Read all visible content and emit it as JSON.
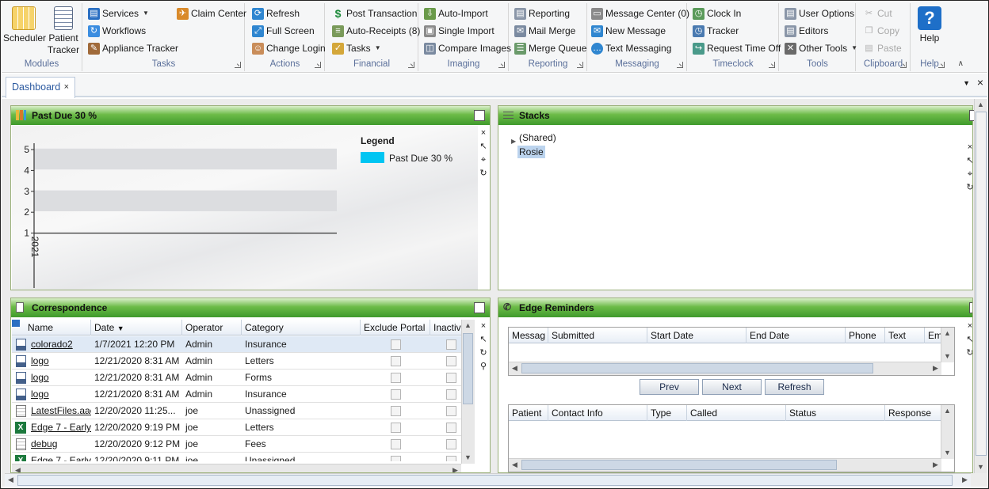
{
  "ribbon": {
    "modules": {
      "label": "Modules",
      "scheduler": "Scheduler",
      "patient_tracker_1": "Patient",
      "patient_tracker_2": "Tracker"
    },
    "tasks": {
      "label": "Tasks",
      "services": "Services",
      "workflows": "Workflows",
      "appliance_tracker": "Appliance Tracker",
      "claim_center": "Claim Center"
    },
    "actions": {
      "label": "Actions",
      "refresh": "Refresh",
      "full_screen": "Full Screen",
      "change_login": "Change Login"
    },
    "financial": {
      "label": "Financial",
      "post_transaction": "Post Transaction",
      "auto_receipts": "Auto-Receipts (8)",
      "tasks": "Tasks"
    },
    "imaging": {
      "label": "Imaging",
      "auto_import": "Auto-Import",
      "single_import": "Single Import",
      "compare_images": "Compare Images"
    },
    "reporting": {
      "label": "Reporting",
      "reporting": "Reporting",
      "mail_merge": "Mail Merge",
      "merge_queue": "Merge Queue"
    },
    "messaging": {
      "label": "Messaging",
      "message_center": "Message Center (0)",
      "new_message": "New Message",
      "text_messaging": "Text Messaging"
    },
    "timeclock": {
      "label": "Timeclock",
      "clock_in": "Clock In",
      "tracker": "Tracker",
      "request_time_off": "Request Time Off"
    },
    "tools": {
      "label": "Tools",
      "user_options": "User Options",
      "editors": "Editors",
      "other_tools": "Other Tools"
    },
    "clipboard": {
      "label": "Clipboard",
      "cut": "Cut",
      "copy": "Copy",
      "paste": "Paste"
    },
    "help": {
      "label": "Help",
      "help": "Help"
    }
  },
  "tabs": [
    {
      "label": "Dashboard"
    }
  ],
  "icons": {
    "close": "×",
    "dropdown": "▼"
  },
  "panels": {
    "past_due": {
      "title": "Past Due 30 %",
      "chart_data": {
        "type": "bar",
        "series": [
          {
            "name": "Past Due 30 %",
            "values": []
          }
        ],
        "categories": [
          "2021"
        ],
        "yticks": [
          1,
          2,
          3,
          4,
          5
        ],
        "ylim": [
          0,
          5
        ],
        "legend_title": "Legend",
        "legend_color": "#00c5f2",
        "legend_position": "top-right"
      }
    },
    "stacks": {
      "title": "Stacks",
      "items": [
        {
          "label": "(Shared)"
        },
        {
          "label": "Rosie"
        }
      ]
    },
    "correspondence": {
      "title": "Correspondence",
      "columns": [
        "Name",
        "Date",
        "Operator",
        "Category",
        "Exclude Portal",
        "Inactiv"
      ],
      "rows": [
        {
          "name": "colorado2",
          "date": "1/7/2021 12:20 PM",
          "operator": "Admin",
          "category": "Insurance",
          "type": "doc"
        },
        {
          "name": "logo",
          "date": "12/21/2020 8:31 AM",
          "operator": "Admin",
          "category": "Letters",
          "type": "doc"
        },
        {
          "name": "logo",
          "date": "12/21/2020 8:31 AM",
          "operator": "Admin",
          "category": "Forms",
          "type": "doc"
        },
        {
          "name": "logo",
          "date": "12/21/2020 8:31 AM",
          "operator": "Admin",
          "category": "Insurance",
          "type": "doc"
        },
        {
          "name": "LatestFiles.aac",
          "date": "12/20/2020 11:25...",
          "operator": "joe",
          "category": "Unassigned",
          "type": "file"
        },
        {
          "name": "Edge 7 -  Early",
          "date": "12/20/2020 9:19 PM",
          "operator": "joe",
          "category": "Letters",
          "type": "xls"
        },
        {
          "name": "debug",
          "date": "12/20/2020 9:12 PM",
          "operator": "joe",
          "category": "Fees",
          "type": "file"
        },
        {
          "name": "Edge 7 -  Early",
          "date": "12/20/2020 9:11 PM",
          "operator": "joe",
          "category": "Unassigned",
          "type": "xls"
        }
      ]
    },
    "edge_reminders": {
      "title": "Edge Reminders",
      "grid1_columns": [
        "Messag",
        "Submitted",
        "Start Date",
        "End Date",
        "Phone",
        "Text",
        "Em"
      ],
      "buttons": {
        "prev": "Prev",
        "next": "Next",
        "refresh": "Refresh"
      },
      "grid2_columns": [
        "Patient",
        "Contact Info",
        "Type",
        "Called",
        "Status",
        "Response"
      ]
    }
  }
}
